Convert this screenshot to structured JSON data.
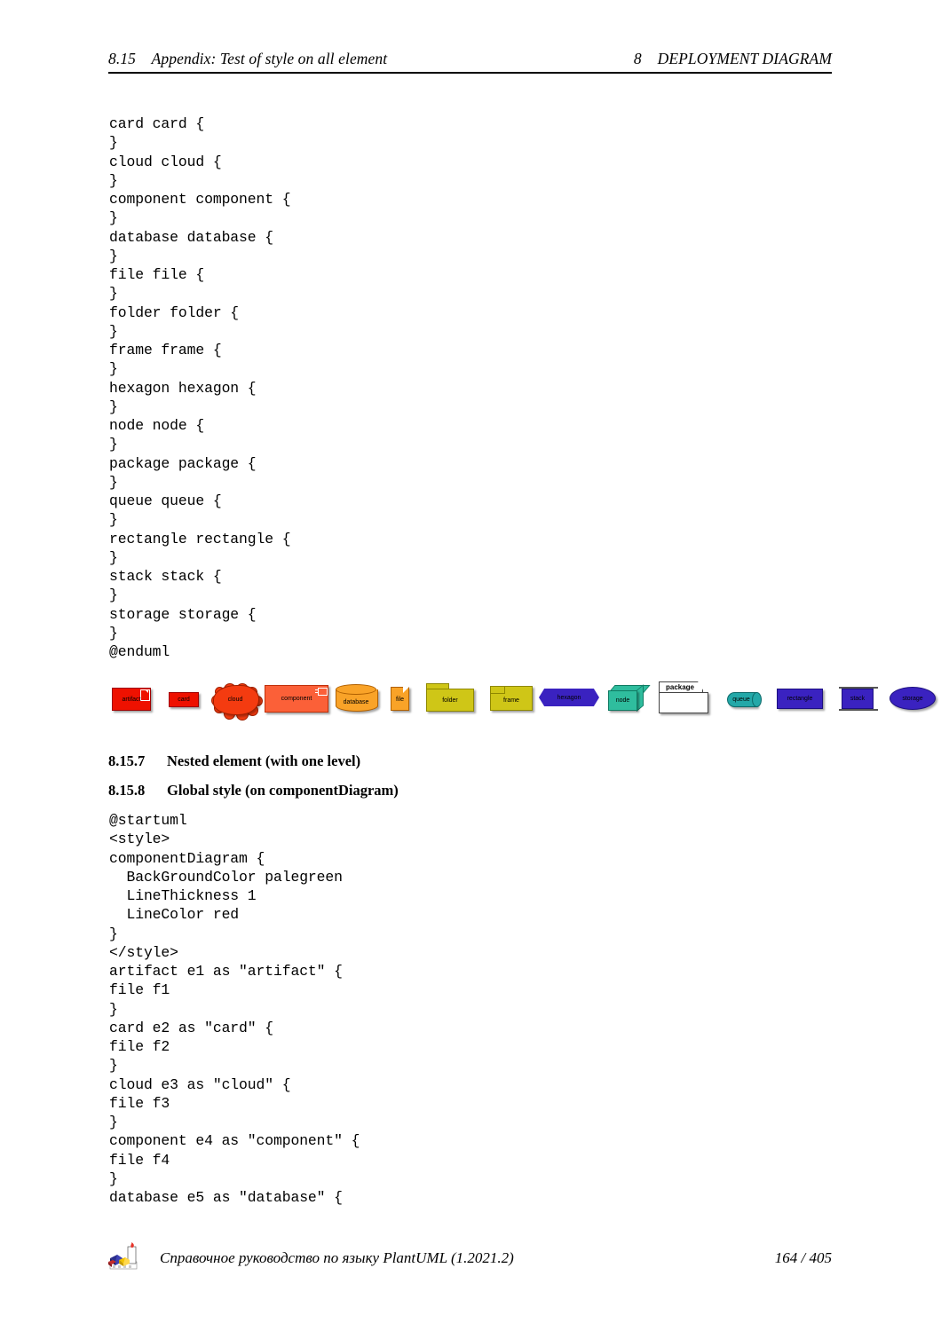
{
  "header": {
    "left_number": "8.15",
    "left_title": "Appendix: Test of style on all element",
    "right_number": "8",
    "right_title": "DEPLOYMENT DIAGRAM"
  },
  "code_block_1": {
    "lines": [
      "card card {",
      "}",
      "cloud cloud {",
      "}",
      "component component {",
      "}",
      "database database {",
      "}",
      "file file {",
      "}",
      "folder folder {",
      "}",
      "frame frame {",
      "}",
      "hexagon hexagon {",
      "}",
      "node node {",
      "}",
      "package package {",
      "}",
      "queue queue {",
      "}",
      "rectangle rectangle {",
      "}",
      "stack stack {",
      "}",
      "storage storage {",
      "}",
      "@enduml"
    ]
  },
  "diagram": {
    "shapes": [
      {
        "id": "artifact",
        "label": "artifact",
        "color": "#EE1100",
        "kind": "artifact"
      },
      {
        "id": "card",
        "label": "card",
        "color": "#EE1100",
        "kind": "card"
      },
      {
        "id": "cloud",
        "label": "cloud",
        "color": "#F43B10",
        "kind": "cloud"
      },
      {
        "id": "component",
        "label": "component",
        "color": "#FB6038",
        "kind": "component"
      },
      {
        "id": "database",
        "label": "database",
        "color": "#F9A328",
        "kind": "database"
      },
      {
        "id": "file",
        "label": "file",
        "color": "#F9A328",
        "kind": "file"
      },
      {
        "id": "folder",
        "label": "folder",
        "color": "#CFC617",
        "kind": "folder"
      },
      {
        "id": "frame",
        "label": "frame",
        "color": "#CFC617",
        "kind": "frame"
      },
      {
        "id": "hexagon",
        "label": "hexagon",
        "color": "#3A22C0",
        "kind": "hexagon"
      },
      {
        "id": "node",
        "label": "node",
        "color": "#2FBD9E",
        "kind": "node"
      },
      {
        "id": "package",
        "label": "package",
        "color": "#FFFFFF",
        "kind": "package"
      },
      {
        "id": "queue",
        "label": "queue",
        "color": "#23A8A8",
        "kind": "queue"
      },
      {
        "id": "rectangle",
        "label": "rectangle",
        "color": "#3A22C0",
        "kind": "rectangle"
      },
      {
        "id": "stack",
        "label": "stack",
        "color": "#3A22C0",
        "kind": "stack"
      },
      {
        "id": "storage",
        "label": "storage",
        "color": "#3A22C0",
        "kind": "storage"
      }
    ]
  },
  "headings": {
    "h_8_15_7": {
      "number": "8.15.7",
      "title": "Nested element (with one level)"
    },
    "h_8_15_8": {
      "number": "8.15.8",
      "title": "Global style (on componentDiagram)"
    }
  },
  "code_block_2": {
    "lines": [
      "@startuml",
      "<style>",
      "componentDiagram {",
      "  BackGroundColor palegreen",
      "  LineThickness 1",
      "  LineColor red",
      "}",
      "</style>",
      "artifact e1 as \"artifact\" {",
      "file f1",
      "}",
      "card e2 as \"card\" {",
      "file f2",
      "}",
      "cloud e3 as \"cloud\" {",
      "file f3",
      "}",
      "component e4 as \"component\" {",
      "file f4",
      "}",
      "database e5 as \"database\" {"
    ]
  },
  "footer": {
    "title": "Справочное руководство по языку PlantUML (1.2021.2)",
    "page": "164 / 405",
    "logo": "plantuml-logo-icon"
  }
}
